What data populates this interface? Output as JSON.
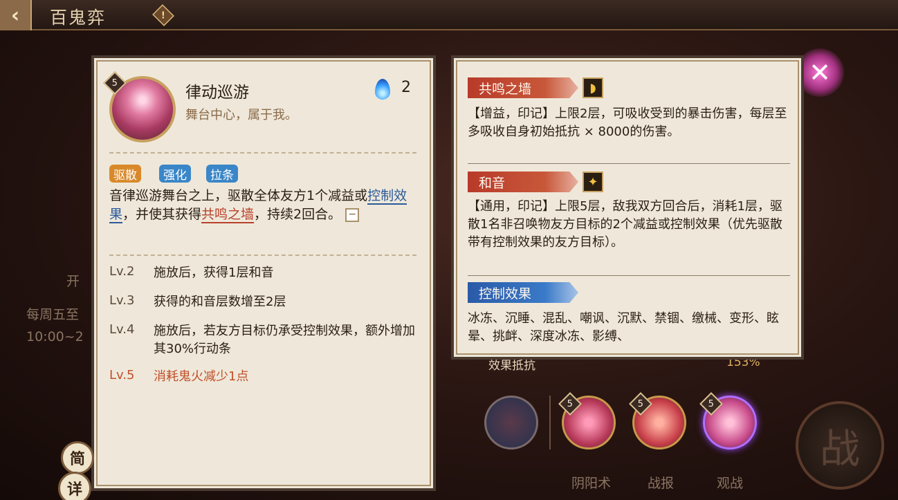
{
  "header": {
    "back_icon": "back-arrow-icon",
    "title": "百鬼弈",
    "warn_symbol": "!"
  },
  "background": {
    "stat_label": "效果抵抗",
    "stat_value": "153%",
    "faded_texts": [
      "开",
      "每周五至",
      "10:00~2"
    ],
    "nav_labels": [
      "阴阳术",
      "战报",
      "观战"
    ],
    "battle_label": "战",
    "close_symbol": "✕"
  },
  "shikigami_row": {
    "levels": [
      "5",
      "5",
      "5"
    ]
  },
  "toggles": {
    "brief": "简",
    "detail": "详"
  },
  "skill": {
    "level": "5",
    "name": "律动巡游",
    "description": "舞台中心，属于我。",
    "cost_icon": "ghost-fire-icon",
    "cost": "2",
    "tags": [
      "驱散",
      "强化",
      "拉条"
    ],
    "main_text": {
      "part1": "音律巡游舞台之上，驱散全体友方1个减益或",
      "kw1": "控制效果",
      "part2": "，并使其获得",
      "kw2": "共鸣之墙",
      "part3": "，持续2回合。",
      "collapse": "−"
    },
    "levels": [
      {
        "label": "Lv.2",
        "text": "施放后，获得1层和音"
      },
      {
        "label": "Lv.3",
        "text": "获得的和音层数增至2层"
      },
      {
        "label": "Lv.4",
        "text": "施放后，若友方目标仍承受控制效果，额外增加其30%行动条"
      },
      {
        "label": "Lv.5",
        "text": "消耗鬼火减少1点"
      }
    ]
  },
  "details": {
    "sections": [
      {
        "title": "共鸣之墙",
        "icon": "shield-icon",
        "icon_glyph": "◗",
        "text": "【增益，印记】上限2层，可吸收受到的暴击伤害，每层至多吸收自身初始抵抗 × 8000的伤害。"
      },
      {
        "title": "和音",
        "icon": "star-note-icon",
        "icon_glyph": "✦",
        "text": "【通用，印记】上限5层，敌我双方回合后，消耗1层，驱散1名非召唤物友方目标的2个减益或控制效果（优先驱散带有控制效果的友方目标）。"
      },
      {
        "title": "控制效果",
        "text": "冰冻、沉睡、混乱、嘲讽、沉默、禁锢、缴械、变形、眩晕、挑衅、深度冰冻、影缚、"
      }
    ]
  }
}
